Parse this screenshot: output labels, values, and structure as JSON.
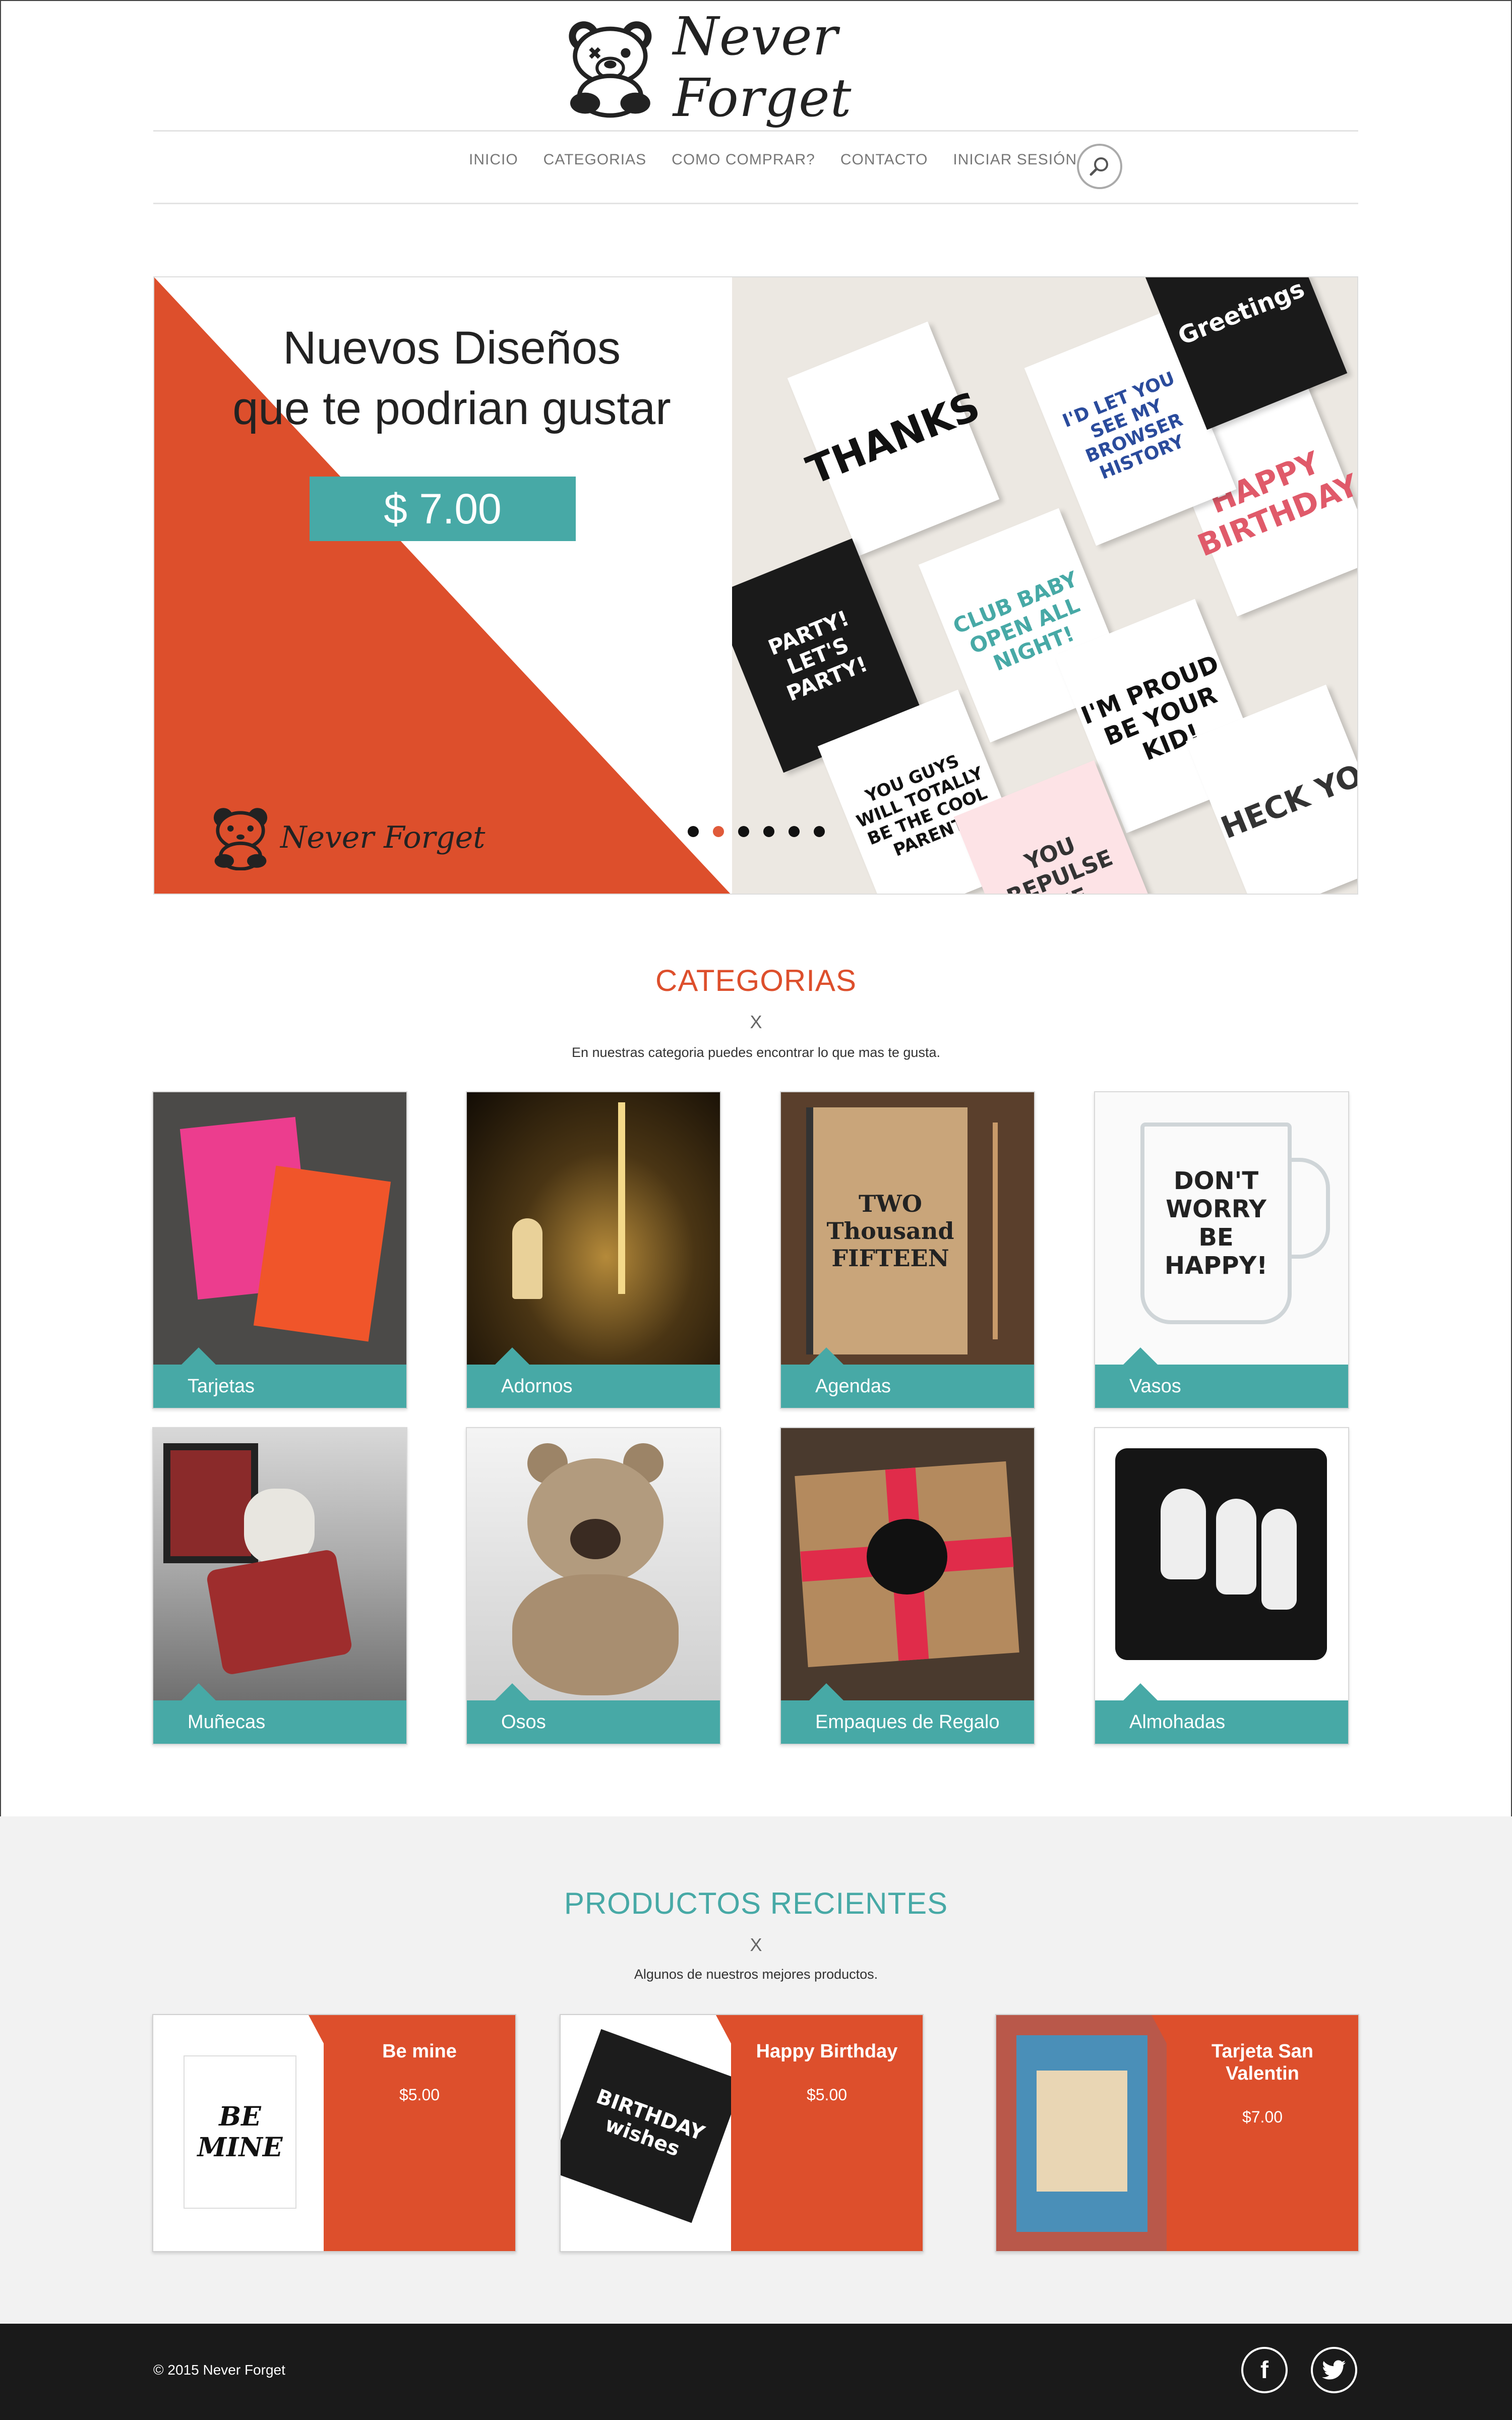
{
  "brand": {
    "name": "Never Forget"
  },
  "nav": {
    "items": [
      "INICIO",
      "CATEGORIAS",
      "COMO COMPRAR?",
      "CONTACTO",
      "INICIAR SESIÓN"
    ],
    "search_icon": "search-icon"
  },
  "slider": {
    "title_line1": "Nuevos Diseños",
    "title_line2": "que te podrian gustar",
    "price": "$ 7.00",
    "logo_text": "Never Forget",
    "cards": [
      "THANKS",
      "HAPPY BIRTHDAY",
      "CLUB BABY OPEN ALL NIGHT!",
      "PARTY! LET'S PARTY!",
      "I'M PROUD BE YOUR KID!",
      "YOU GUYS WILL TOTALLY BE THE COOL PARENTS",
      "YOU REPULSE ME",
      "I'D LET YOU SEE MY BROWSER HISTORY",
      "Greetings",
      "HECK YO"
    ],
    "active_dot": 1,
    "dot_count": 6
  },
  "categories": {
    "title": "CATEGORIAS",
    "separator": "X",
    "subtitle": "En nuestras categoria puedes encontrar lo que mas te gusta.",
    "items": [
      {
        "label": "Tarjetas"
      },
      {
        "label": "Adornos"
      },
      {
        "label": "Agendas"
      },
      {
        "label": "Vasos"
      },
      {
        "label": "Muñecas"
      },
      {
        "label": "Osos"
      },
      {
        "label": "Empaques de Regalo"
      },
      {
        "label": "Almohadas"
      }
    ],
    "image_texts": {
      "agenda": "TWO Thousand FIFTEEN",
      "vaso": "DON'T WORRY BE HAPPY!"
    }
  },
  "recent": {
    "title": "PRODUCTOS RECIENTES",
    "separator": "X",
    "subtitle": "Algunos de nuestros mejores productos.",
    "items": [
      {
        "name": "Be mine",
        "price": "$5.00",
        "image_text": "BE MINE"
      },
      {
        "name": "Happy Birthday",
        "price": "$5.00",
        "image_text": "BIRTHDAY wishes"
      },
      {
        "name": "Tarjeta San Valentin",
        "price": "$7.00"
      }
    ]
  },
  "footer": {
    "copyright": "© 2015 Never Forget",
    "social": [
      "facebook-icon",
      "twitter-icon"
    ]
  },
  "colors": {
    "accent_teal": "#47a9a6",
    "accent_orange": "#dd4f2c",
    "footer_bg": "#1a1a1a"
  }
}
